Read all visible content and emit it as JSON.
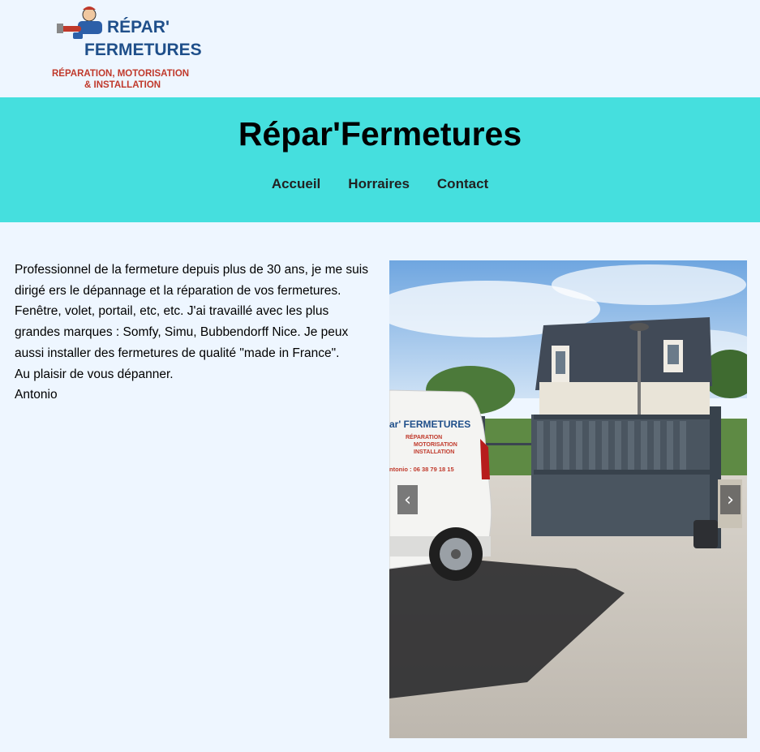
{
  "logo": {
    "line1": "RÉPAR'",
    "line2": "FERMETURES",
    "tag1": "RÉPARATION, MOTORISATION",
    "tag2": "& INSTALLATION"
  },
  "header": {
    "title": "Répar'Fermetures",
    "nav": [
      {
        "label": "Accueil"
      },
      {
        "label": "Horraires"
      },
      {
        "label": "Contact"
      }
    ]
  },
  "intro": {
    "paragraph": "Professionnel de la fermeture depuis plus de 30 ans, je me suis dirigé ers le dépannage et la réparation de vos fermetures. Fenêtre, volet, portail, etc, etc. J'ai travaillé avec les plus grandes marques : Somfy, Simu, Bubbendorff Nice. Je peux aussi installer des fermetures de qualité \"made in France\".",
    "closing": "Au plaisir de vous dépanner.",
    "signature": "Antonio"
  },
  "carousel": {
    "prev_icon": "‹",
    "next_icon": "›",
    "van": {
      "brand": "ar' FERMETURES",
      "sub1": "RÉPARATION",
      "sub2": "MOTORISATION",
      "sub3": "INSTALLATION",
      "phone": "ntonio : 06 38 79 18 15"
    }
  },
  "colors": {
    "header_bg": "#45dfde",
    "page_bg": "#eef6ff",
    "logo_blue": "#1f4f8a",
    "logo_red": "#c0392b"
  }
}
